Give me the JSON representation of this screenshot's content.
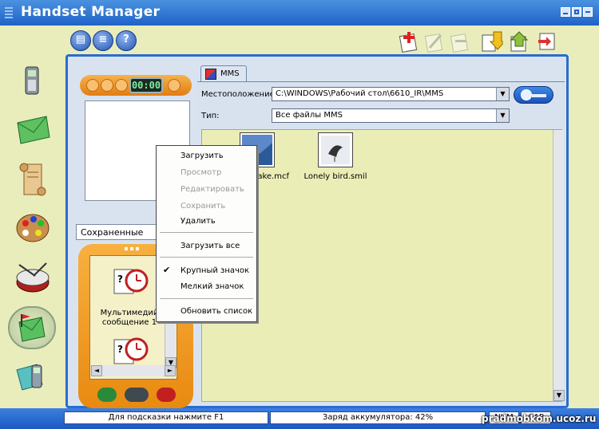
{
  "window": {
    "title": "Handset Manager"
  },
  "toolbar_left": [
    "open-icon",
    "list-icon",
    "help-icon"
  ],
  "toolbar_left_glyphs": [
    "▤",
    "≡",
    "?"
  ],
  "toolbar_right": [
    "new-icon",
    "edit-icon",
    "delete-icon",
    "download-icon",
    "upload-icon",
    "sync-icon"
  ],
  "nav": [
    "phone-icon",
    "message-icon",
    "scroll-icon",
    "palette-icon",
    "drum-icon",
    "mms-icon",
    "handset-icon"
  ],
  "left_panel": {
    "timer": "00:00",
    "saved_combo": "Сохраненные",
    "items": [
      {
        "label": "Мультимедий сообщение 1",
        "icon": "mms-clock-icon"
      },
      {
        "label": "",
        "icon": "mms-clock-icon"
      }
    ]
  },
  "tab": {
    "label": "MMS"
  },
  "form": {
    "location_label": "Местоположение:",
    "location_value": "C:\\WINDOWS\\Рабочий стол\\6610_IR\\MMS",
    "type_label": "Тип:",
    "type_value": "Все файлы MMS"
  },
  "files": [
    {
      "name": "...ake.mcf",
      "icon": "landscape-thumbnail-icon"
    },
    {
      "name": "Lonely bird.smil",
      "icon": "bird-thumbnail-icon"
    }
  ],
  "context_menu": {
    "items": [
      {
        "label": "Загрузить",
        "enabled": true
      },
      {
        "label": "Просмотр",
        "enabled": false
      },
      {
        "label": "Редактировать",
        "enabled": false
      },
      {
        "label": "Сохранить",
        "enabled": false
      },
      {
        "label": "Удалить",
        "enabled": true
      },
      {
        "label": "Загрузить все",
        "enabled": true
      },
      {
        "label": "Крупный значок",
        "enabled": true,
        "checked": true
      },
      {
        "label": "Мелкий значок",
        "enabled": true
      },
      {
        "label": "Обновить список",
        "enabled": true
      }
    ]
  },
  "status": {
    "hint": "Для подсказки нажмите F1",
    "battery": "Заряд аккумулятора: 42%",
    "num": "NUM",
    "caps": "CAP"
  },
  "watermark": "pradmobkom.ucoz.ru",
  "colors": {
    "title_bar": "#1f62c8",
    "accent_orange": "#e88a10",
    "background": "#e9edbb"
  }
}
